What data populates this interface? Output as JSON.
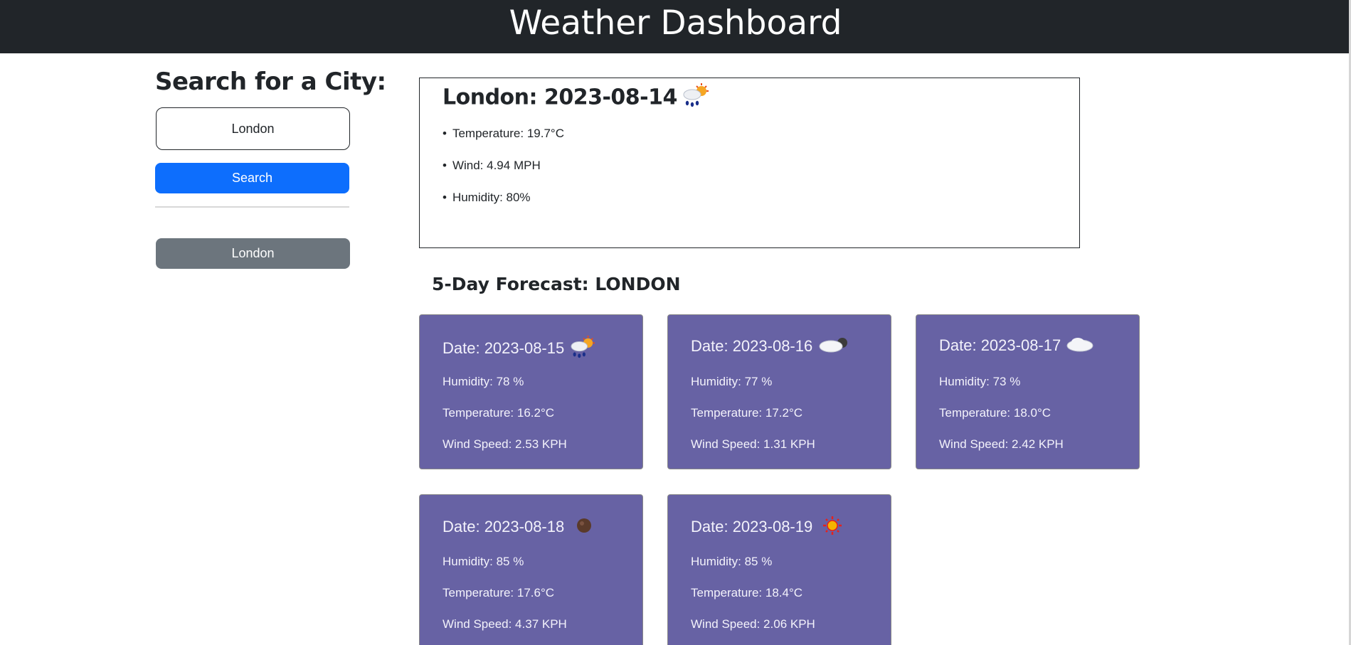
{
  "app": {
    "title": "Weather Dashboard"
  },
  "sidebar": {
    "heading": "Search for a City:",
    "search_value": "London",
    "search_button": "Search",
    "history": [
      "London"
    ]
  },
  "current": {
    "title": "London: 2023-08-14",
    "icon": "rain-sun-icon",
    "temperature": "Temperature: 19.7°C",
    "wind": "Wind: 4.94 MPH",
    "humidity": "Humidity: 80%"
  },
  "forecast": {
    "title": "5-Day Forecast: LONDON",
    "days": [
      {
        "date": "Date: 2023-08-15",
        "icon": "rain-sun-icon",
        "humidity": "Humidity: 78 %",
        "temperature": "Temperature: 16.2°C",
        "wind": "Wind Speed: 2.53 KPH"
      },
      {
        "date": "Date: 2023-08-16",
        "icon": "cloudy-night-icon",
        "humidity": "Humidity: 77 %",
        "temperature": "Temperature: 17.2°C",
        "wind": "Wind Speed: 1.31 KPH"
      },
      {
        "date": "Date: 2023-08-17",
        "icon": "cloud-icon",
        "humidity": "Humidity: 73 %",
        "temperature": "Temperature: 18.0°C",
        "wind": "Wind Speed: 2.42 KPH"
      },
      {
        "date": "Date: 2023-08-18",
        "icon": "dark-moon-icon",
        "humidity": "Humidity: 85 %",
        "temperature": "Temperature: 17.6°C",
        "wind": "Wind Speed: 4.37 KPH"
      },
      {
        "date": "Date: 2023-08-19",
        "icon": "sun-icon",
        "humidity": "Humidity: 85 %",
        "temperature": "Temperature: 18.4°C",
        "wind": "Wind Speed: 2.06 KPH"
      }
    ]
  }
}
